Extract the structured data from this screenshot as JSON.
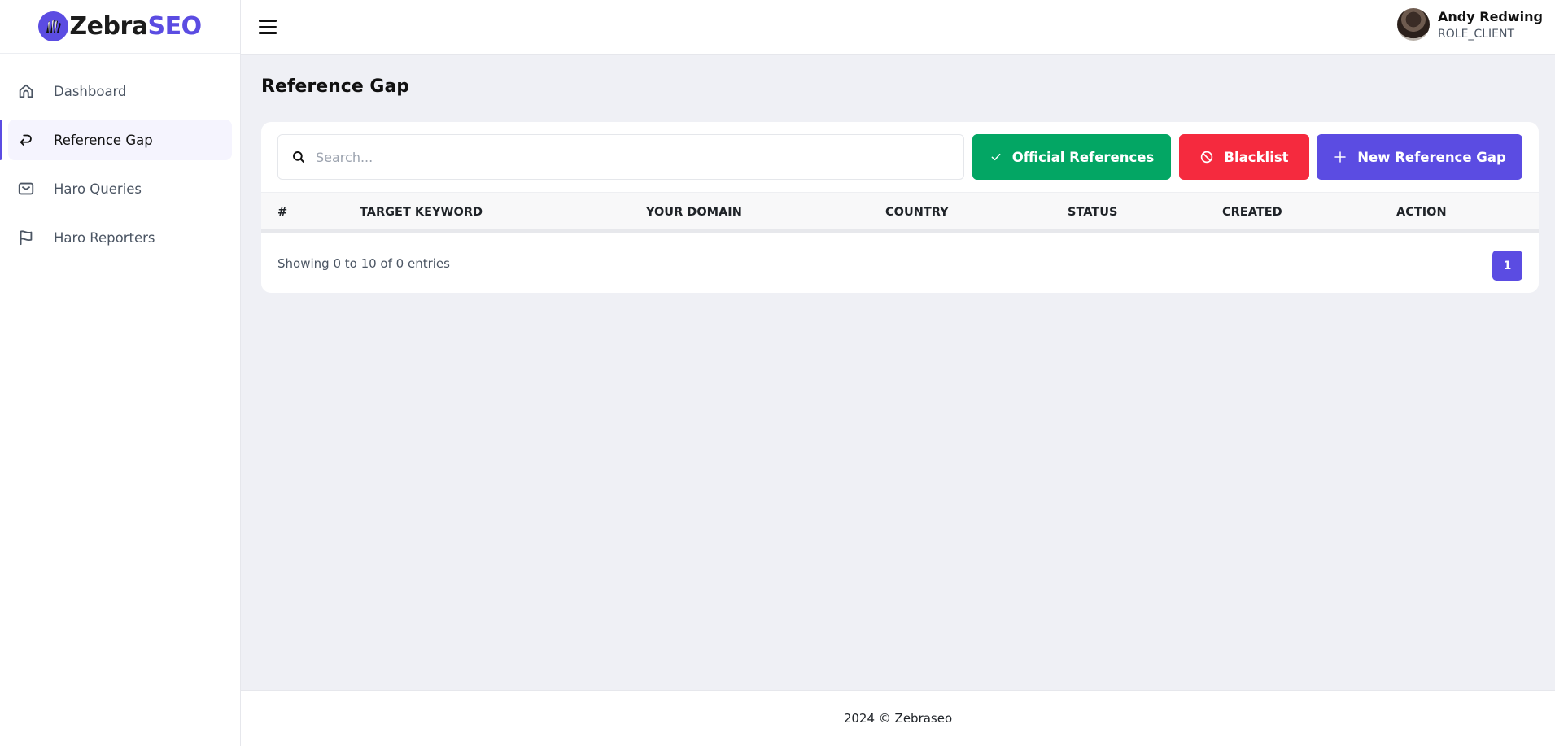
{
  "brand": {
    "name_part1": "Zebra",
    "name_part2": "SEO"
  },
  "sidebar": {
    "items": [
      {
        "label": "Dashboard",
        "icon": "home-icon",
        "active": false
      },
      {
        "label": "Reference Gap",
        "icon": "return-arrow-icon",
        "active": true
      },
      {
        "label": "Haro Queries",
        "icon": "mail-icon",
        "active": false
      },
      {
        "label": "Haro Reporters",
        "icon": "flag-icon",
        "active": false
      }
    ]
  },
  "topbar": {
    "menu_icon": "hamburger-menu-icon",
    "user": {
      "name": "Andy Redwing",
      "role": "ROLE_CLIENT"
    }
  },
  "main": {
    "title": "Reference Gap",
    "search": {
      "placeholder": "Search...",
      "value": ""
    },
    "buttons": {
      "official": "Official References",
      "blacklist": "Blacklist",
      "new": "New Reference Gap"
    },
    "table": {
      "columns": [
        "#",
        "Target Keyword",
        "Your Domain",
        "Country",
        "Status",
        "Created",
        "Action"
      ],
      "rows": []
    },
    "pagination": {
      "summary": "Showing 0 to 10 of 0 entries",
      "current_page": "1"
    }
  },
  "colors": {
    "accent": "#5b4ce2",
    "success": "#03a664",
    "danger": "#f52a3e",
    "background": "#eff0f5"
  },
  "footer": {
    "text": "2024 © Zebraseo"
  }
}
